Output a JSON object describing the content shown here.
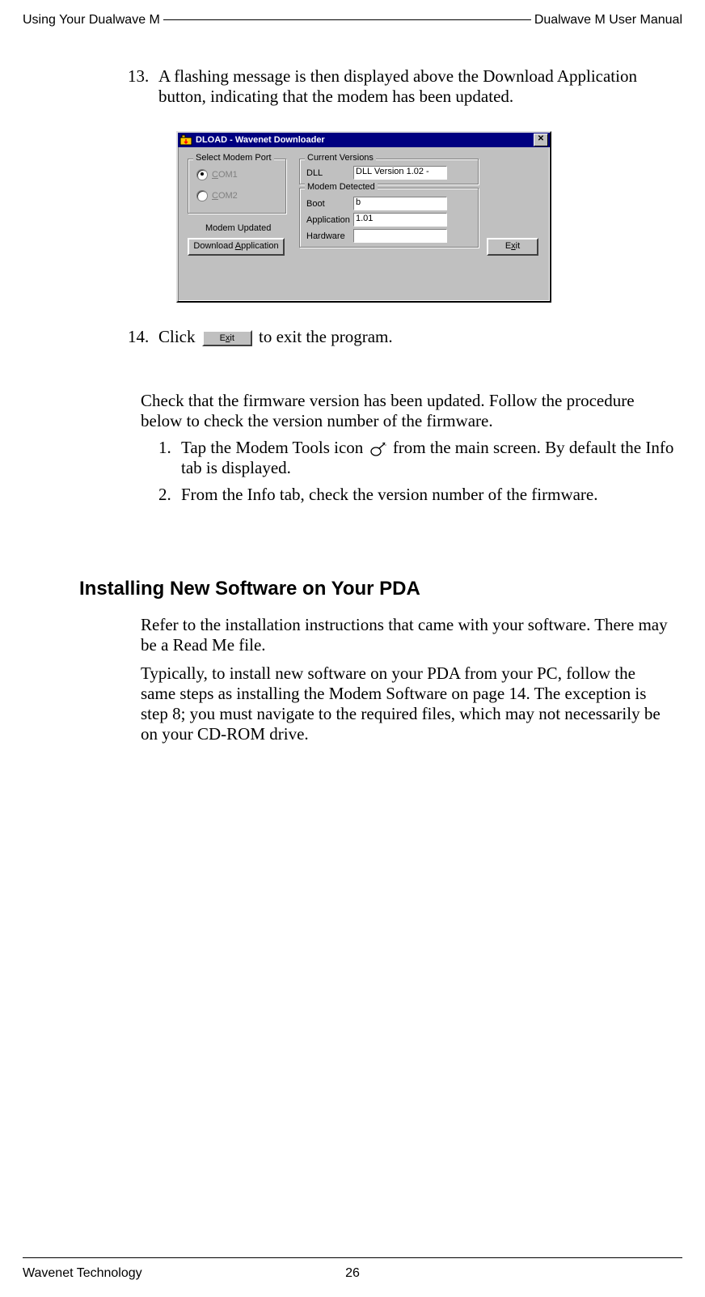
{
  "header": {
    "left": "Using Your Dualwave M",
    "right": "Dualwave M User Manual"
  },
  "steps": {
    "s13_num": "13.",
    "s13_text": "A flashing message is then displayed above the Download Application button, indicating that the modem has been updated.",
    "s14_num": "14.",
    "s14_pre": "Click ",
    "s14_post": " to exit the program."
  },
  "dialog": {
    "title": "DLOAD - Wavenet Downloader",
    "close_glyph": "✕",
    "group_port_title": "Select Modem Port",
    "radio_com1_u": "C",
    "radio_com1_rest": "OM1",
    "radio_com2_u": "C",
    "radio_com2_rest": "OM2",
    "group_cv_title": "Current Versions",
    "group_md_title": "Modem Detected",
    "label_dll": "DLL",
    "value_dll": "DLL Version 1.02 -",
    "label_boot": "Boot",
    "value_boot": "b",
    "label_app": "Application",
    "value_app": "1.01",
    "label_hw": "Hardware",
    "value_hw": "",
    "status_text": "Modem Updated",
    "btn_download_pre": "Download ",
    "btn_download_u": "A",
    "btn_download_post": "pplication",
    "btn_exit_pre": "E",
    "btn_exit_u": "x",
    "btn_exit_post": "it"
  },
  "check": {
    "intro": "Check that the firmware version has been updated. Follow the procedure below to check the version number of the firmware.",
    "i1_num": "1.",
    "i1_pre": "Tap the Modem Tools icon ",
    "i1_post": " from the main screen. By default the Info tab is displayed.",
    "i2_num": "2.",
    "i2_text": "From the Info tab, check the version number of the firmware."
  },
  "section": {
    "title": "Installing New Software on Your PDA",
    "p1": "Refer to the installation instructions that came with your software. There may be a Read Me file.",
    "p2": "Typically, to install new software on your PDA from your PC, follow the same steps as installing the Modem Software on page 14. The exception is step 8; you must navigate to the required files, which may not necessarily be on your CD-ROM drive."
  },
  "footer": {
    "left": "Wavenet Technology",
    "page": "26"
  }
}
